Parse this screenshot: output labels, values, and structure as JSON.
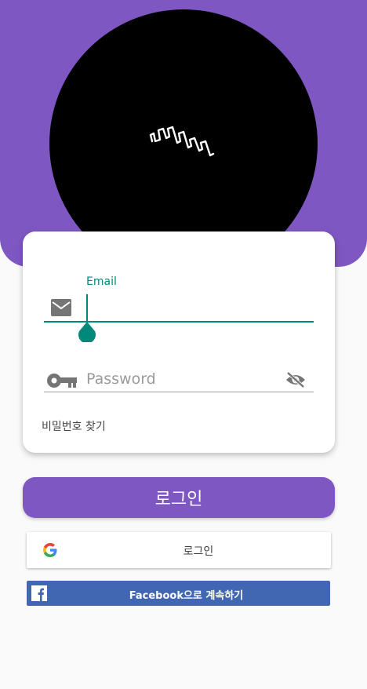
{
  "header": {
    "logo_icon": "signature-logo-icon"
  },
  "login_form": {
    "email_label": "Email",
    "email_value": "",
    "email_icon": "mail-icon",
    "password_placeholder": "Password",
    "password_icon": "key-icon",
    "toggle_visibility_icon": "eye-off-icon",
    "find_password_link": "비밀번호 찾기"
  },
  "actions": {
    "login_button": "로그인",
    "google_button": "로그인",
    "google_icon": "google-icon",
    "facebook_button": "Facebook으로 계속하기",
    "facebook_icon": "facebook-icon"
  },
  "colors": {
    "primary": "#7e57c2",
    "accent": "#00897b",
    "facebook": "#4267b2"
  }
}
